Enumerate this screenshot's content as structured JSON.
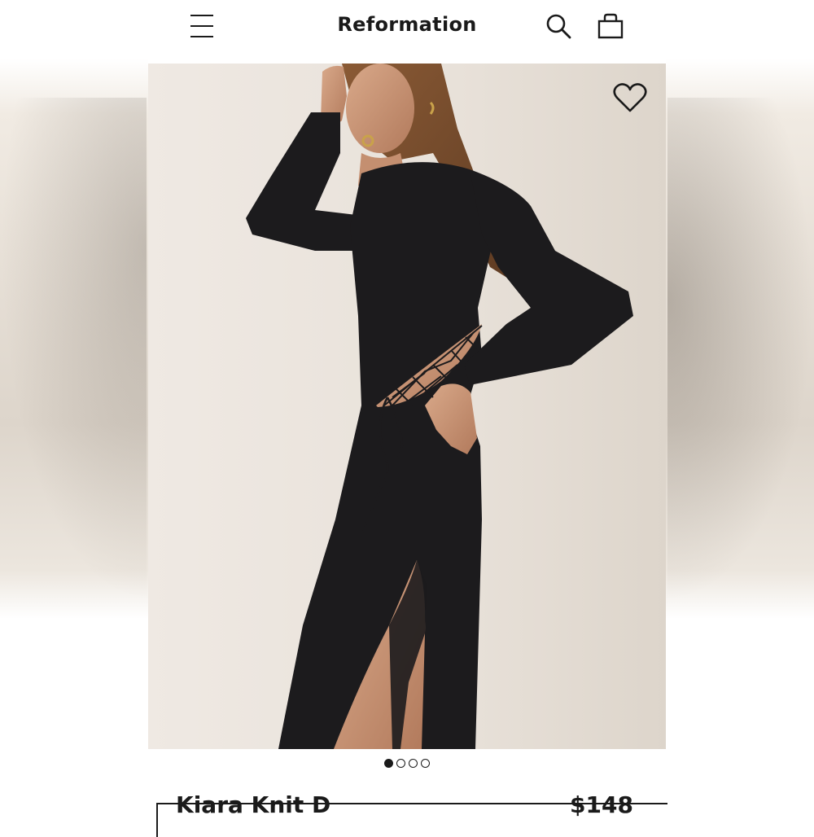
{
  "header": {
    "brand": "Reformation",
    "menu_icon": "hamburger-menu-icon",
    "search_icon": "search-icon",
    "bag_icon": "shopping-bag-icon"
  },
  "product": {
    "image_alt": "",
    "wishlist_icon": "heart-outline-icon",
    "carousel": {
      "total": 4,
      "active_index": 0
    },
    "name": "Kiara Knit D",
    "price": "$148"
  },
  "colors": {
    "text": "#1a1a1a",
    "dress": "#1c1b1d",
    "background": "#ebe4dc"
  }
}
